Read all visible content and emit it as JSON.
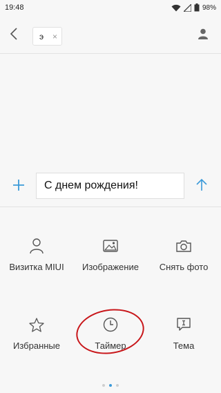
{
  "status_bar": {
    "time": "19:48",
    "battery": "98%",
    "icons": [
      "wifi-icon",
      "sim-signal-icon",
      "battery-icon"
    ]
  },
  "header": {
    "recipient": "э",
    "chip_close": "×",
    "icons": [
      "back-arrow-icon",
      "contact-icon"
    ]
  },
  "compose": {
    "text": "С днем рождения!",
    "icons": [
      "plus-icon",
      "send-arrow-icon"
    ]
  },
  "attachments": [
    {
      "label": "Визитка MIUI",
      "icon": "person-icon"
    },
    {
      "label": "Изображение",
      "icon": "image-icon"
    },
    {
      "label": "Снять фото",
      "icon": "camera-icon"
    },
    {
      "label": "Избранные",
      "icon": "star-icon"
    },
    {
      "label": "Таймер",
      "icon": "clock-icon"
    },
    {
      "label": "Тема",
      "icon": "subject-icon"
    }
  ],
  "pager": {
    "pages": 3,
    "active": 2
  },
  "colors": {
    "accent": "#3b9ad9",
    "highlight": "#c8161a",
    "background": "#f7f7f7"
  }
}
